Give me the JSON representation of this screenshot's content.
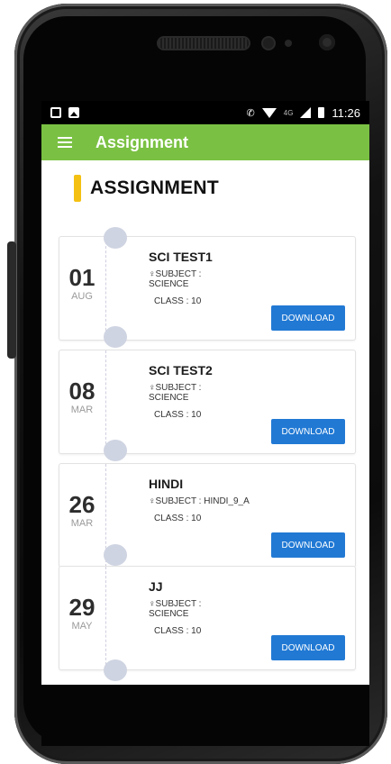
{
  "status_bar": {
    "time": "11:26",
    "network": "4G"
  },
  "app_bar": {
    "title": "Assignment"
  },
  "section": {
    "title": "ASSIGNMENT"
  },
  "assignments": [
    {
      "title": "SCI TEST1",
      "subject": "♀SUBJECT :\nSCIENCE",
      "class": "CLASS : 10",
      "day": "01",
      "month": "AUG",
      "button": "DOWNLOAD"
    },
    {
      "title": "SCI TEST2",
      "subject": "♀SUBJECT :\nSCIENCE",
      "class": "CLASS : 10",
      "day": "08",
      "month": "MAR",
      "button": "DOWNLOAD"
    },
    {
      "title": "HINDI",
      "subject": "♀SUBJECT : HINDI_9_A",
      "class": "CLASS : 10",
      "day": "26",
      "month": "MAR",
      "button": "DOWNLOAD"
    },
    {
      "title": "JJ",
      "subject": "♀SUBJECT :\nSCIENCE",
      "class": "CLASS : 10",
      "day": "29",
      "month": "MAY",
      "button": "DOWNLOAD"
    }
  ]
}
